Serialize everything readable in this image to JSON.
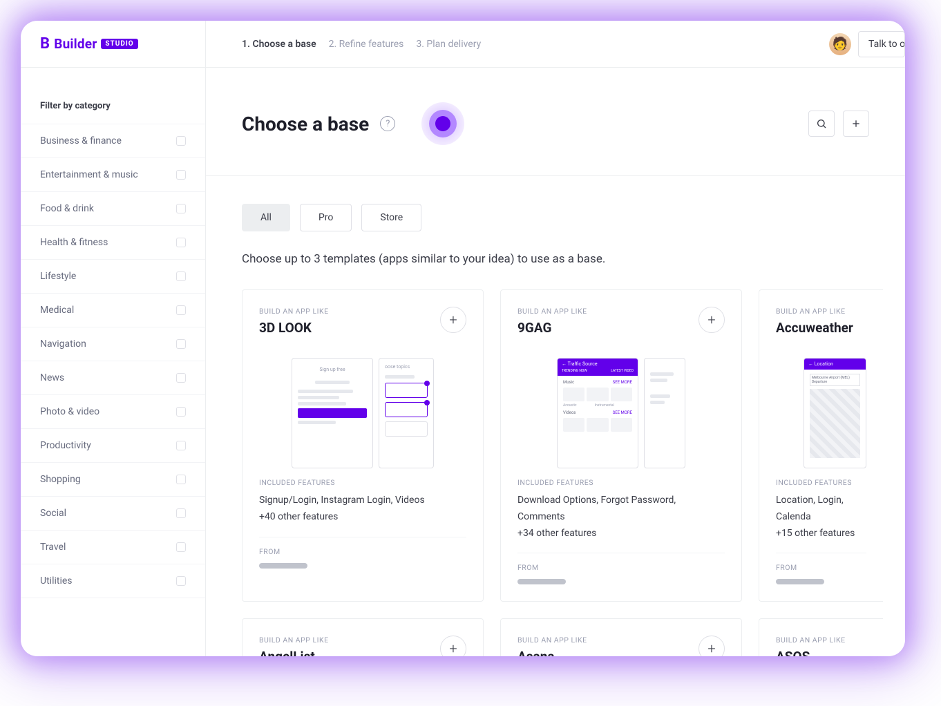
{
  "brand": {
    "name": "Builder",
    "badge": "STUDIO"
  },
  "steps": {
    "s1": "1. Choose a base",
    "s2": "2. Refine features",
    "s3": "3. Plan delivery"
  },
  "header": {
    "talk": "Talk to o"
  },
  "page": {
    "title": "Choose a base",
    "subtitle": "Choose up to 3 templates (apps similar to your idea) to use as a base."
  },
  "sidebar": {
    "filterTitle": "Filter by category",
    "categories": [
      "Business & finance",
      "Entertainment & music",
      "Food & drink",
      "Health & fitness",
      "Lifestyle",
      "Medical",
      "Navigation",
      "News",
      "Photo & video",
      "Productivity",
      "Shopping",
      "Social",
      "Travel",
      "Utilities"
    ]
  },
  "tabs": {
    "all": "All",
    "pro": "Pro",
    "store": "Store"
  },
  "labels": {
    "buildLike": "BUILD AN APP LIKE",
    "included": "INCLUDED FEATURES",
    "from": "FROM"
  },
  "templates": {
    "row1": [
      {
        "name": "3D LOOK",
        "features": "Signup/Login, Instagram Login, Videos",
        "more": "+40 other features"
      },
      {
        "name": "9GAG",
        "features": "Download Options, Forgot Password, Comments",
        "more": "+34 other features"
      },
      {
        "name": "Accuweather",
        "features": "Location, Login, Calenda",
        "more": "+15 other features"
      }
    ],
    "row2": [
      {
        "name": "AngelList"
      },
      {
        "name": "Asana"
      },
      {
        "name": "ASOS"
      }
    ]
  },
  "mock": {
    "signup": "Sign up free",
    "topics": "oose topics",
    "traffic": "Traffic Source",
    "trending": "TRENDING NOW",
    "latest": "LATEST VIDEO",
    "music": "Music",
    "acoustic": "Acoustic",
    "instrumental": "Instrumental",
    "videos": "Videos",
    "seemore": "SEE MORE",
    "location": "Location",
    "airport": "Melbourne Airport (MEL) Departure"
  }
}
